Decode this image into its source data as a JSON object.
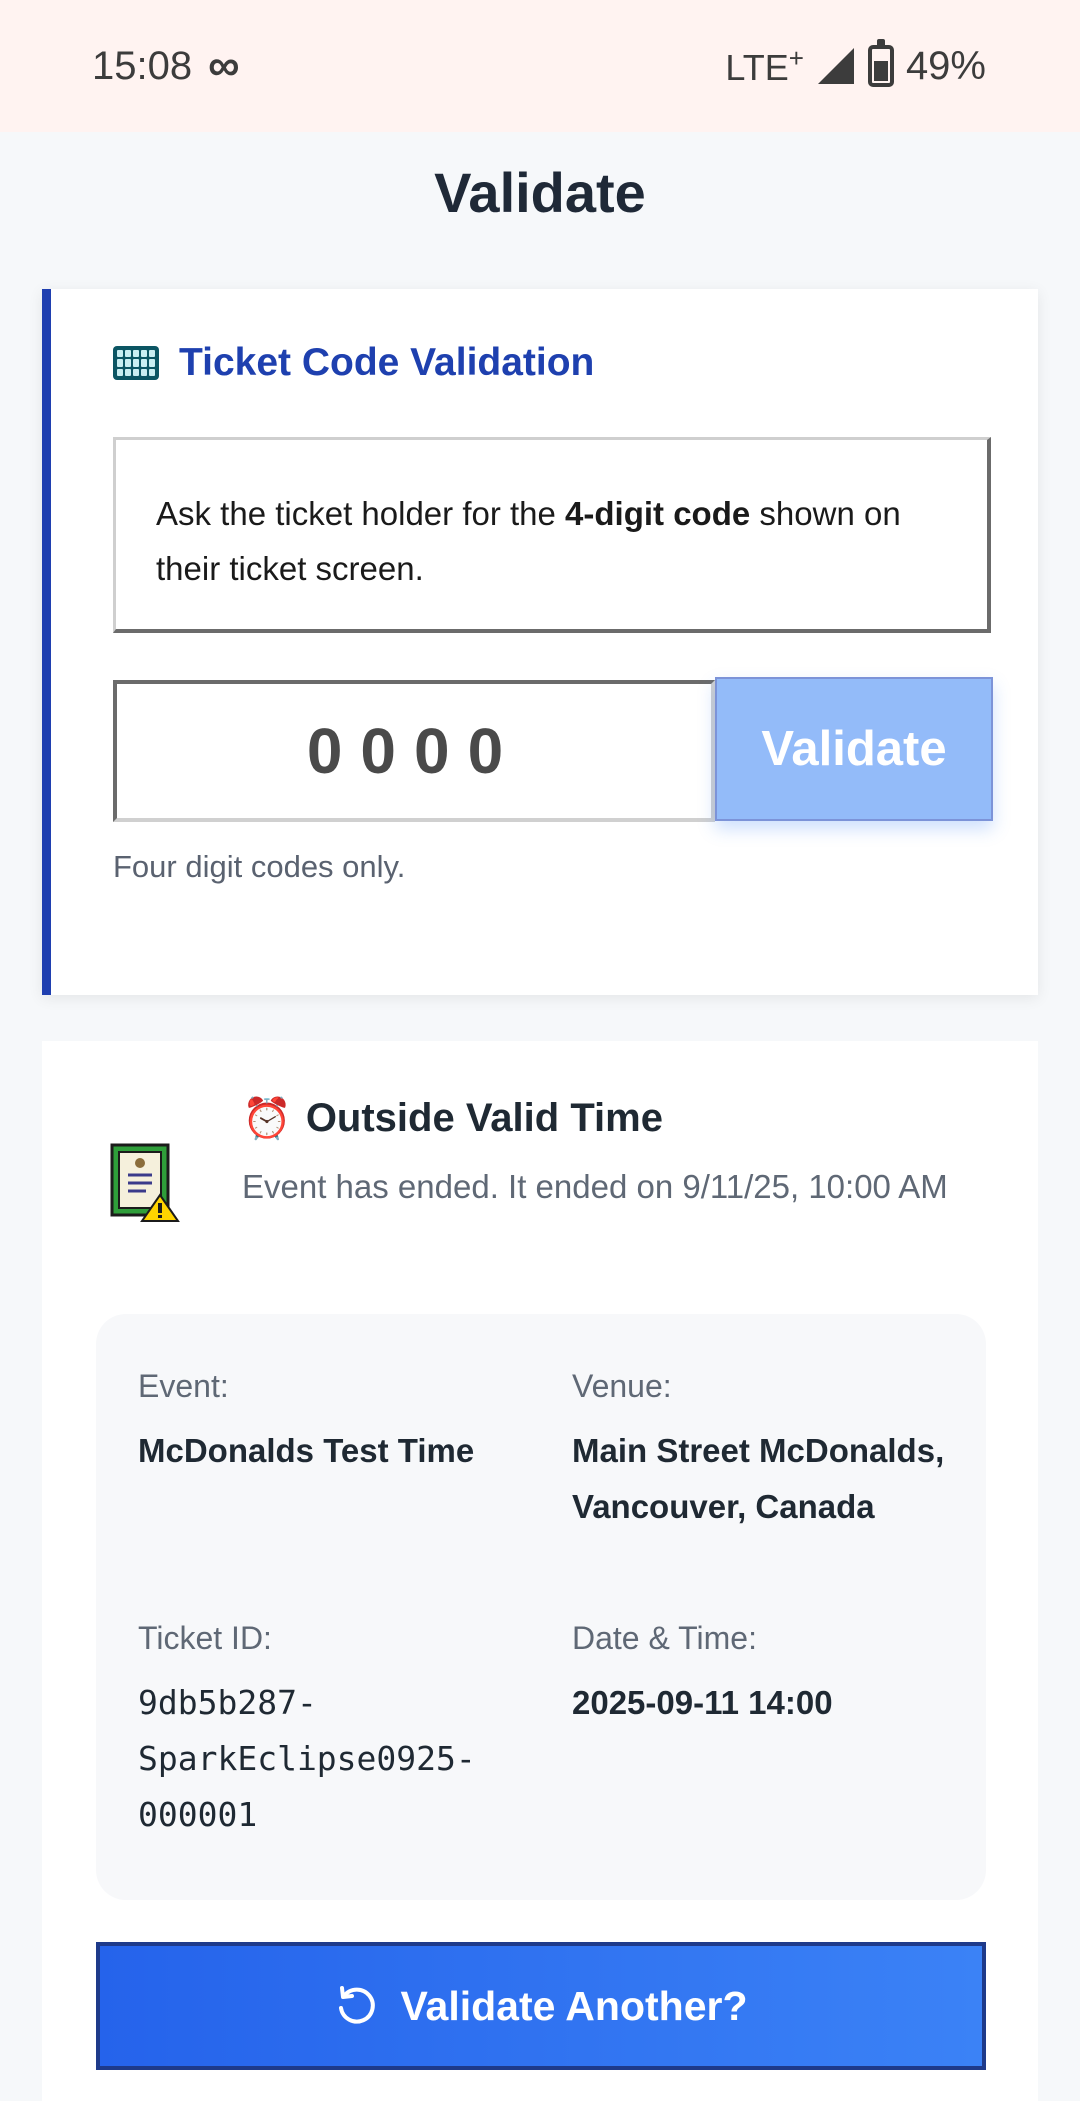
{
  "status_bar": {
    "time": "15:08",
    "infinity_glyph": "∞",
    "network": "LTE",
    "network_plus": "+",
    "battery": "49%"
  },
  "page": {
    "title": "Validate"
  },
  "validation_card": {
    "title": "Ticket Code Validation",
    "icon": "keypad-icon",
    "info_prefix": "Ask the ticket holder for the ",
    "info_bold": "4-digit code",
    "info_suffix": " shown on their ticket screen.",
    "code_placeholder": "0000",
    "code_value": "",
    "validate_label": "Validate",
    "hint": "Four digit codes only."
  },
  "result_card": {
    "status_icon": "alarm-clock-icon",
    "status_title": "Outside Valid Time",
    "status_message": "Event has ended. It ended on 9/11/25, 10:00 AM",
    "details": {
      "event_label": "Event:",
      "event_value": "McDonalds Test Time",
      "venue_label": "Venue:",
      "venue_value": "Main Street McDonalds, Vancouver, Canada",
      "ticket_label": "Ticket ID:",
      "ticket_value": "9db5b287-SparkEclipse0925-000001",
      "date_label": "Date & Time:",
      "date_value": "2025-09-11 14:00"
    },
    "again_label": "Validate Another?",
    "colors": {
      "accent": "#1e40af",
      "button": "#2563eb",
      "validate_disabled": "#93bbf9"
    }
  }
}
